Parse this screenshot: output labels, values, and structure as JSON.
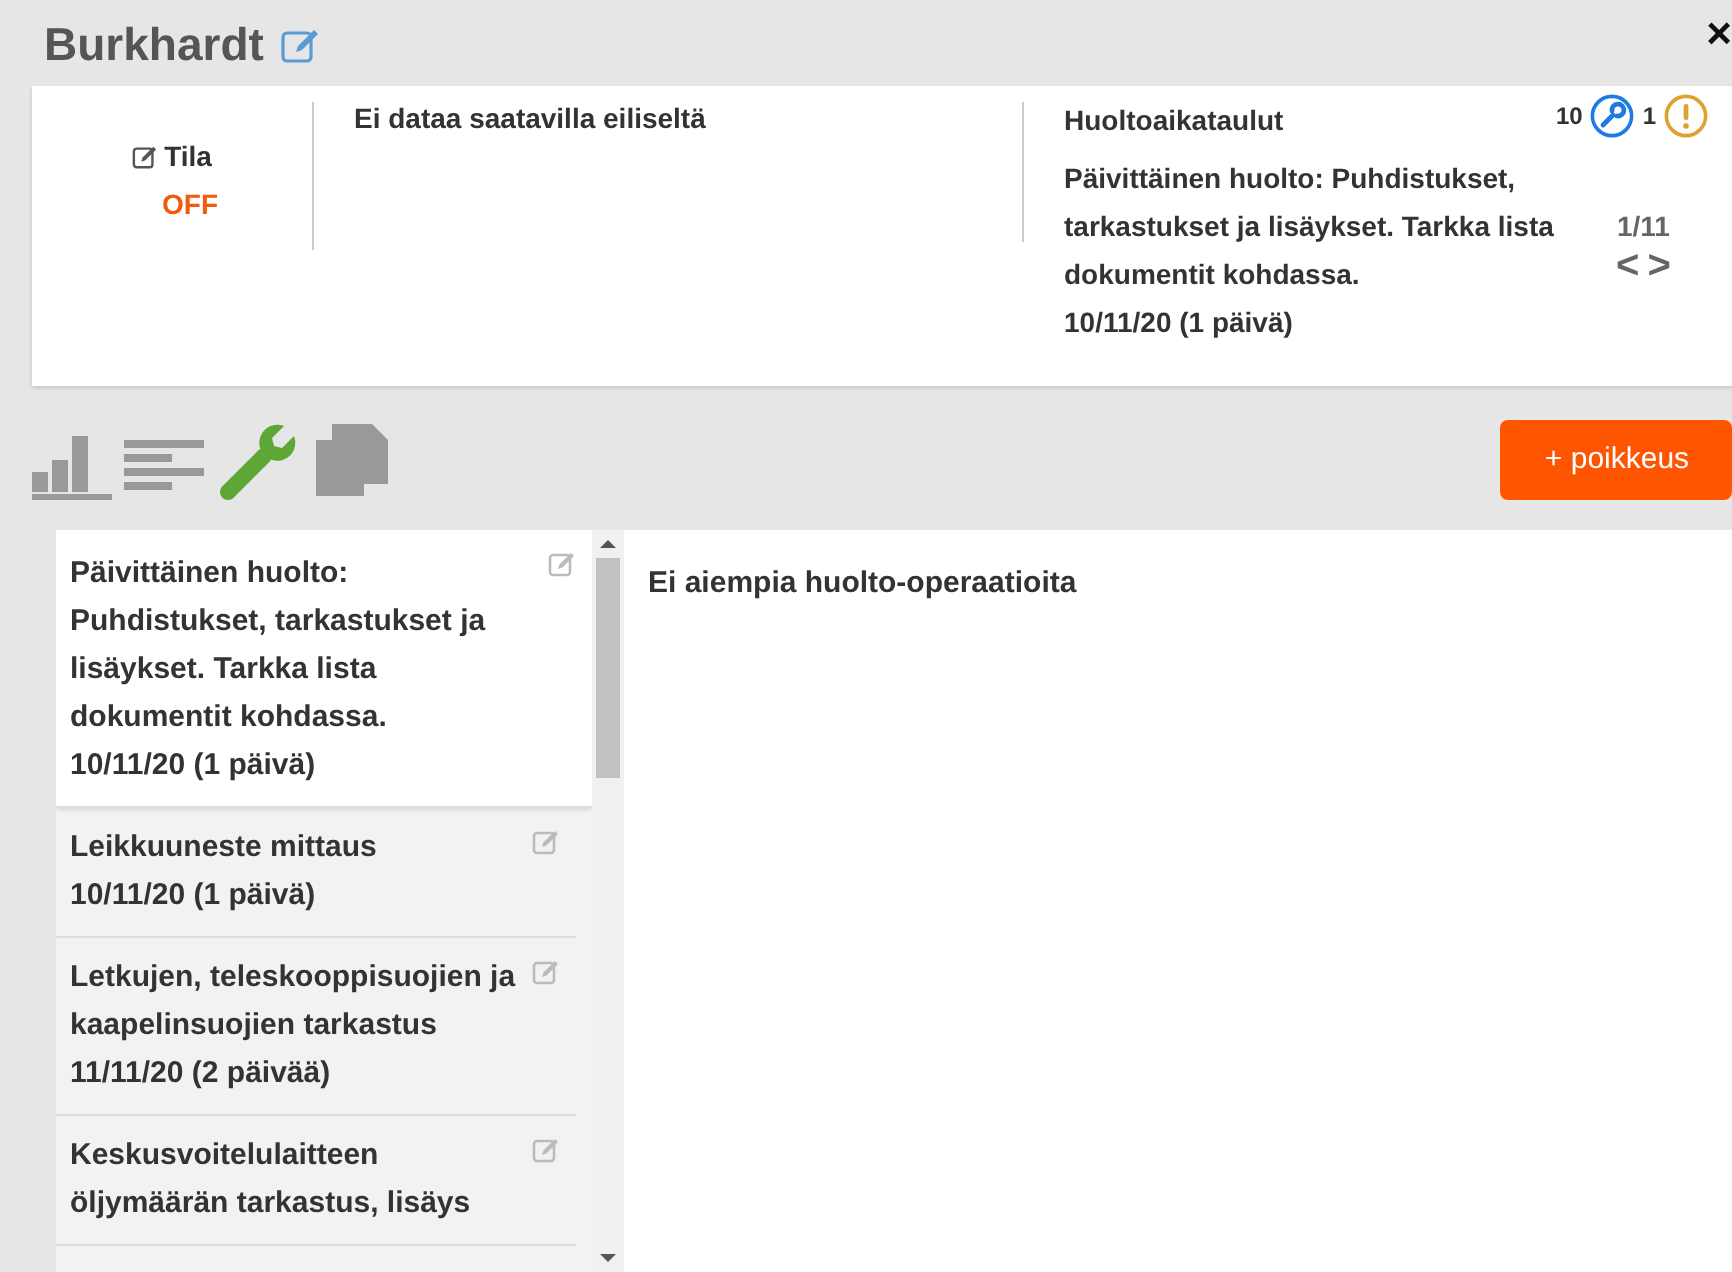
{
  "header": {
    "title": "Burkhardt",
    "close": "×"
  },
  "status": {
    "label": "Tila",
    "value": "OFF"
  },
  "yesterday": {
    "text": "Ei dataa saatavilla eiliseltä"
  },
  "schedules": {
    "title": "Huoltoaikataulut",
    "maintenance_count": "10",
    "warning_count": "1",
    "current": "Päivittäinen huolto: Puhdistukset, tarkastukset ja lisäykset. Tarkka lista dokumentit kohdassa.",
    "current_date": "10/11/20 (1 päivä)",
    "pager": "1/11",
    "prev": "<",
    "next": ">"
  },
  "tabs": [
    {
      "selected": false
    },
    {
      "selected": false
    },
    {
      "selected": true
    },
    {
      "selected": false
    }
  ],
  "add_button": "+ poikkeus",
  "tasks": [
    {
      "text": "Päivittäinen huolto: Puhdistukset, tarkastukset ja lisäykset. Tarkka lista dokumentit kohdassa.",
      "date": "10/11/20 (1 päivä)",
      "selected": true
    },
    {
      "text": "Leikkuuneste mittaus",
      "date": "10/11/20 (1 päivä)",
      "selected": false
    },
    {
      "text": "Letkujen, teleskooppisuojien ja kaapelinsuojien tarkastus",
      "date": "11/11/20 (2 päivää)",
      "selected": false
    },
    {
      "text": "Keskusvoitelulaitteen öljymäärän tarkastus, lisäys",
      "selected": false
    }
  ],
  "history": {
    "empty_text": "Ei aiempia huolto-operaatioita"
  }
}
